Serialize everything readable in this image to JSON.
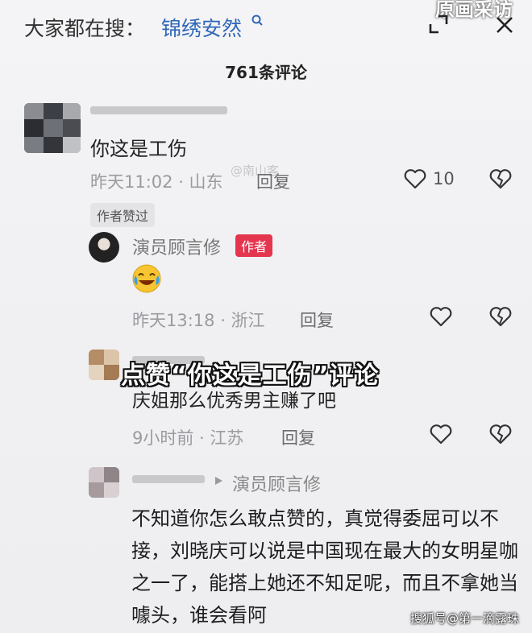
{
  "header": {
    "search_prefix": "大家都在搜：",
    "search_term": "锦绣安然",
    "corner_text": "原画采访"
  },
  "comments_count_title": "761条评论",
  "comment_1": {
    "text": "你这是工伤",
    "time_location": "昨天11:02 · 山东",
    "reply_label": "回复",
    "like_count": "10",
    "badge": "作者赞过"
  },
  "reply_1": {
    "author": "演员顾言修",
    "author_badge": "作者",
    "emoji": "😂",
    "time_location": "昨天13:18 · 浙江",
    "reply_label": "回复"
  },
  "overlay_caption": "点赞“你这是工伤”评论",
  "comment_2": {
    "text": "庆姐那么优秀男主赚了吧",
    "time_location": "9小时前 · 江苏",
    "reply_label": "回复"
  },
  "comment_3": {
    "reply_to": "演员顾言修",
    "text": "不知道你怎么敢点赞的，真觉得委屈可以不接，刘晓庆可以说是中国现在最大的女明星咖之一了，能搭上她还不知足呢，而且不拿她当噱头，谁会看阿"
  },
  "watermark_top": "@南山客",
  "watermark_bottom": "搜狐号@第一滴露珠",
  "colors": {
    "link_blue": "#2f67b7",
    "author_red": "#e5364f",
    "meta_gray": "#9a9aa0"
  },
  "icons": [
    "search-icon",
    "expand-icon",
    "close-icon",
    "heart-icon",
    "broken-heart-icon",
    "arrow-right-icon",
    "laugh-cry-emoji"
  ]
}
